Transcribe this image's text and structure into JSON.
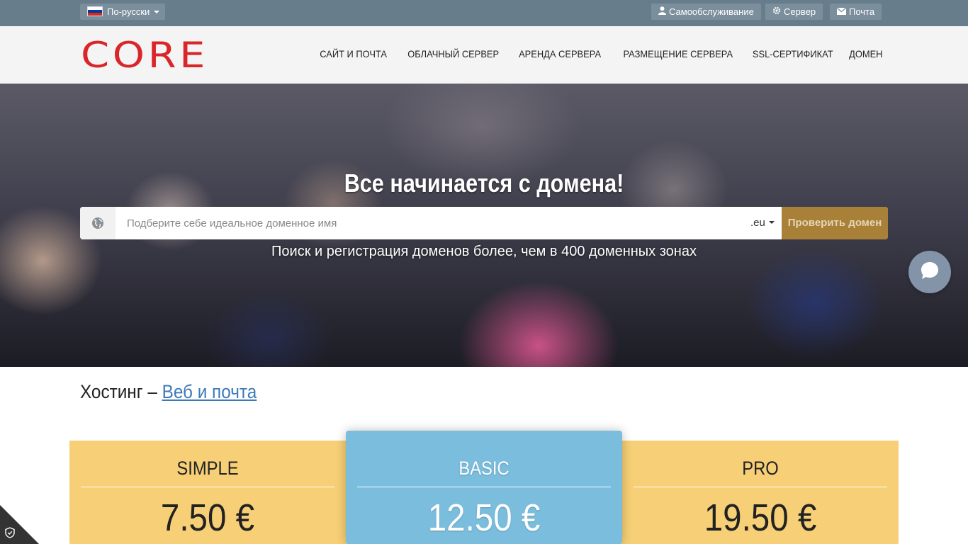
{
  "topbar": {
    "language": "По-русски",
    "links": [
      {
        "label": "Самообслуживание",
        "icon": "user-icon"
      },
      {
        "label": "Сервер",
        "icon": "gear-icon"
      },
      {
        "label": "Почта",
        "icon": "envelope-icon"
      }
    ]
  },
  "header": {
    "logo": "CORE",
    "nav": [
      "САЙТ И ПОЧТА",
      "ОБЛАЧНЫЙ СЕРВЕР",
      "АРЕНДА СЕРВЕРА",
      "РАЗМЕЩЕНИЕ СЕРВЕРА",
      "SSL-СЕРТИФИКАТ",
      "ДОМЕН"
    ]
  },
  "hero": {
    "title": "Все начинается с домена!",
    "search": {
      "placeholder": "Подберите себе идеальное доменное имя",
      "value": "",
      "tld": ".eu",
      "button": "Проверить домен"
    },
    "subtitle": "Поиск и регистрация доменов более, чем в 400 доменных зонах"
  },
  "hosting": {
    "title_prefix": "Хостинг – ",
    "title_link": "Веб и почта",
    "plans": [
      {
        "name": "SIMPLE",
        "price": "7.50 €"
      },
      {
        "name": "BASIC",
        "price": "12.50 €"
      },
      {
        "name": "PRO",
        "price": "19.50 €"
      }
    ]
  },
  "colors": {
    "topbar": "#687d8c",
    "brand_red": "#d8262b",
    "check_button": "#a98038",
    "plan_yellow": "#f6cf76",
    "plan_blue": "#7bbddd"
  }
}
